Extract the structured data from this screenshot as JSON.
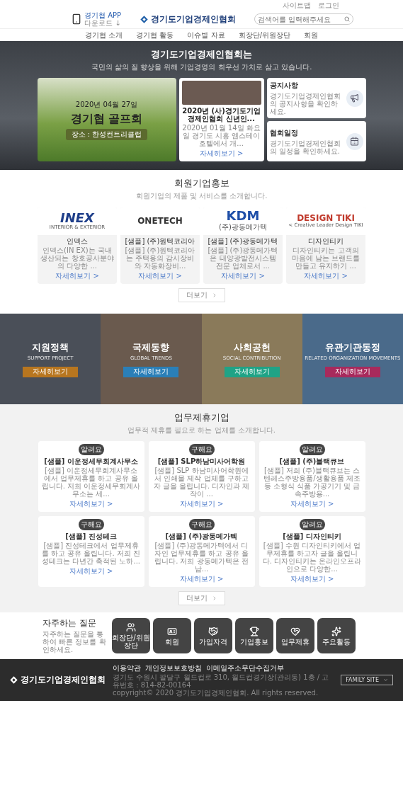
{
  "util_links": [
    "사이트맵",
    "로그인"
  ],
  "header": {
    "app_title": "경기협 APP",
    "app_sub": "다운로드 ↓",
    "logo": "경기도기업경제인협회",
    "search": {
      "placeholder": "검색어를 입력해주세요"
    }
  },
  "nav": [
    "경기협 소개",
    "경기협 활동",
    "이슈별 자료",
    "회장단/위원장단",
    "회원"
  ],
  "hero": {
    "title": "경기도기업경제인협회는",
    "subtitle": "국민의 삶의 질 향상을 위해 기업경영의 최우선 가치로 삼고 있습니다.",
    "banner": {
      "date": "2020년 04월 27일",
      "title": "경기협 골프회",
      "place": "장소 : 한성컨트리클럽"
    },
    "news": {
      "title": "2020년 (사)경기도기업경제인협회 신년인...",
      "desc": "2020년 01월 14일 화요일 경기도 시흥 엠스테이호텔에서 개...",
      "link": "자세히보기 >"
    },
    "quick": [
      {
        "kind": "notice",
        "title": "공지사항",
        "desc": "경기도기업경제인협회의 공지사항을 확인하세요."
      },
      {
        "kind": "schedule",
        "title": "협회일정",
        "desc": "경기도기업경제인협회의 일정을 확인하세요."
      }
    ]
  },
  "members": {
    "title": "회원기업홍보",
    "subtitle": "회원기업의 제품 및 서비스를 소개합니다.",
    "more": "더보기",
    "items": [
      {
        "logo": "INEX",
        "logo_sub": "INTERIOR & EXTERIOR",
        "name": "인덱스",
        "desc": "인덱스(IN EX)는 국내 생산되는 창호공사분야의 다양한 ...",
        "link": "자세히보기 >"
      },
      {
        "logo": "ONETECH",
        "name": "[샘플] (주)원텍코리아",
        "desc": "[샘플] (주)원텍코리아는 주택용의 감시장비와 자동화장비...",
        "link": "자세히보기 >"
      },
      {
        "logo": "KDM",
        "logo_sub": "(주)광동메가텍",
        "name": "[샘플] (주)광동메가텍",
        "desc": "[샘플] (주)광동메가텍은 태양광발전시스템 전문 업체로서 ...",
        "link": "자세히보기 >"
      },
      {
        "logo": "DESIGN TIKI",
        "logo_sub": "< Creative Leader Design TIKI",
        "name": "디자인티키",
        "desc": "디자인티키는 고객의 마음에 남는 브랜드를 만들고 유지하기 ...",
        "link": "자세히보기 >"
      }
    ]
  },
  "categories": [
    {
      "title": "지원정책",
      "subtitle": "SUPPORT PROJECT",
      "button": "자세히보기",
      "color": "#b8761f"
    },
    {
      "title": "국제동향",
      "subtitle": "GLOBAL TRENDS",
      "button": "자세히보기",
      "color": "#2a7fb8"
    },
    {
      "title": "사회공헌",
      "subtitle": "SOCIAL CONTRIBUTION",
      "button": "자세히보기",
      "color": "#1fa386"
    },
    {
      "title": "유관기관동정",
      "subtitle": "RELATED ORGANIZATION MOVEMENTS",
      "button": "자세히보기",
      "color": "#a82a5c"
    }
  ],
  "partners": {
    "title": "업무제휴기업",
    "subtitle": "업무적 제휴를 필요로 하는 업체를 소개합니다.",
    "more": "더보기",
    "items": [
      {
        "badge": "알려요",
        "title": "[샘플] 이운정세무회계사무소",
        "desc": "[샘플] 이운정세무회계사무소에서 업무제휴를 하고 공유 올립니다. 저희 이운정세무회계사무소는 세...",
        "link": "자세히보기 >"
      },
      {
        "badge": "구해요",
        "title": "[샘플] SLP하남미사어학원",
        "desc": "[샘플] SLP 하남미사어학원에서 인쇄물 제작 업체를 구하고자 글을 올립니다. 디자인과 제작이 ...",
        "link": "자세히보기 >"
      },
      {
        "badge": "알려요",
        "title": "[샘플] (주)블랙큐브",
        "desc": "[샘플] 저희 (주)블랙큐브는 스텐레스주방용품/생활용품 제조 등 소형식 식품 가공기기 및 금속주방용...",
        "link": "자세히보기 >"
      },
      {
        "badge": "구해요",
        "title": "[샘플] 진성테크",
        "desc": "[샘플] 진성테크에서 업무제휴를 하고 공유 올립니다. 저희 진성테크는 다년간 축적된 노하...",
        "link": "자세히보기 >"
      },
      {
        "badge": "구해요",
        "title": "[샘플] (주)광동메가텍",
        "desc": "[샘플] (주)광동메가텍에서 디자인 업무제휴를 하고 공유 올립니다. 저희 광동메가텍은 전남...",
        "link": "자세히보기 >"
      },
      {
        "badge": "알려요",
        "title": "[샘플] 디자인티키",
        "desc": "[샘플] 수원 디자인티키에서 업무제휴를 하고자 글을 올립니다. 디자인티키는 온라인오프라인으로 다양한...",
        "link": "자세히보기 >"
      }
    ]
  },
  "faq": {
    "title": "자주하는 질문",
    "desc": "자주하는 질문을 통하여 빠른 정보를 확인하세요.",
    "items": [
      "회장단/위원장단",
      "회원",
      "가입자격",
      "기업홍보",
      "업무제휴",
      "주요활동"
    ]
  },
  "footer": {
    "logo": "경기도기업경제인협회",
    "links": [
      "이용약관",
      "개인정보보호방침",
      "이메일주소무단수집거부"
    ],
    "address": "경기도 수원시 팔달구 월드컵로 310, 월드컵경기장(관리동) 1층 / 고유번호 : 814-82-00164",
    "copyright": "copyright© 2020 경기도기업경제인협회. All rights reserved.",
    "family_site": "FAMILY SITE"
  }
}
